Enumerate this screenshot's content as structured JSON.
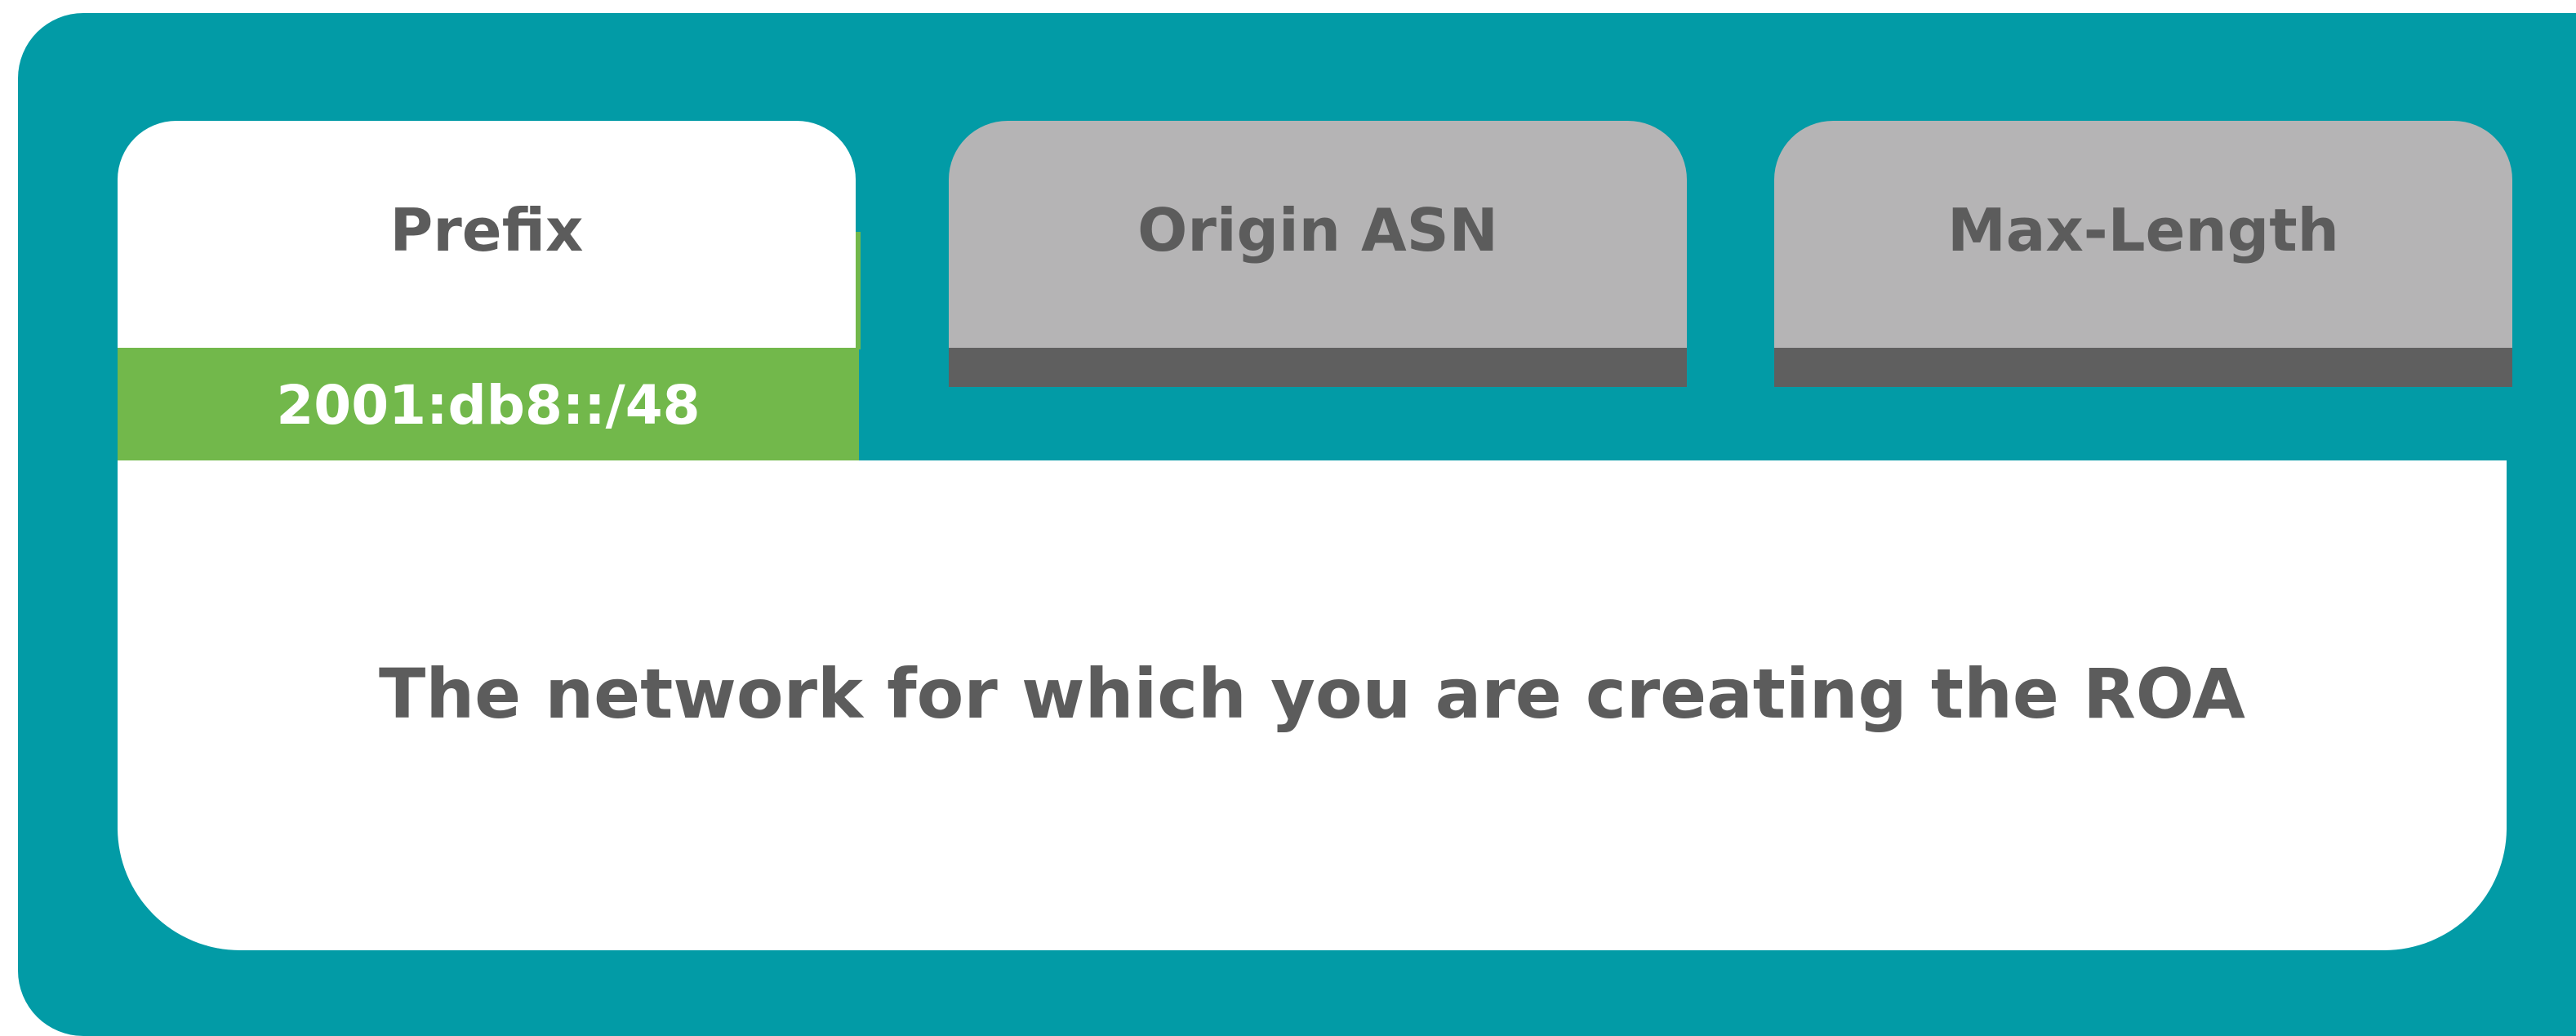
{
  "tabs": [
    {
      "label": "Prefix",
      "active": true
    },
    {
      "label": "Origin ASN",
      "active": false
    },
    {
      "label": "Max-Length",
      "active": false
    }
  ],
  "prefix_value": "2001:db8::/48",
  "description": "The network for which you are creating the ROA",
  "colors": {
    "frame": "#029ba6",
    "active_tab": "#ffffff",
    "inactive_tab": "#b5b4b5",
    "inactive_strip": "#5f5f5f",
    "value_band": "#72b84b",
    "text": "#5c5c5c"
  }
}
